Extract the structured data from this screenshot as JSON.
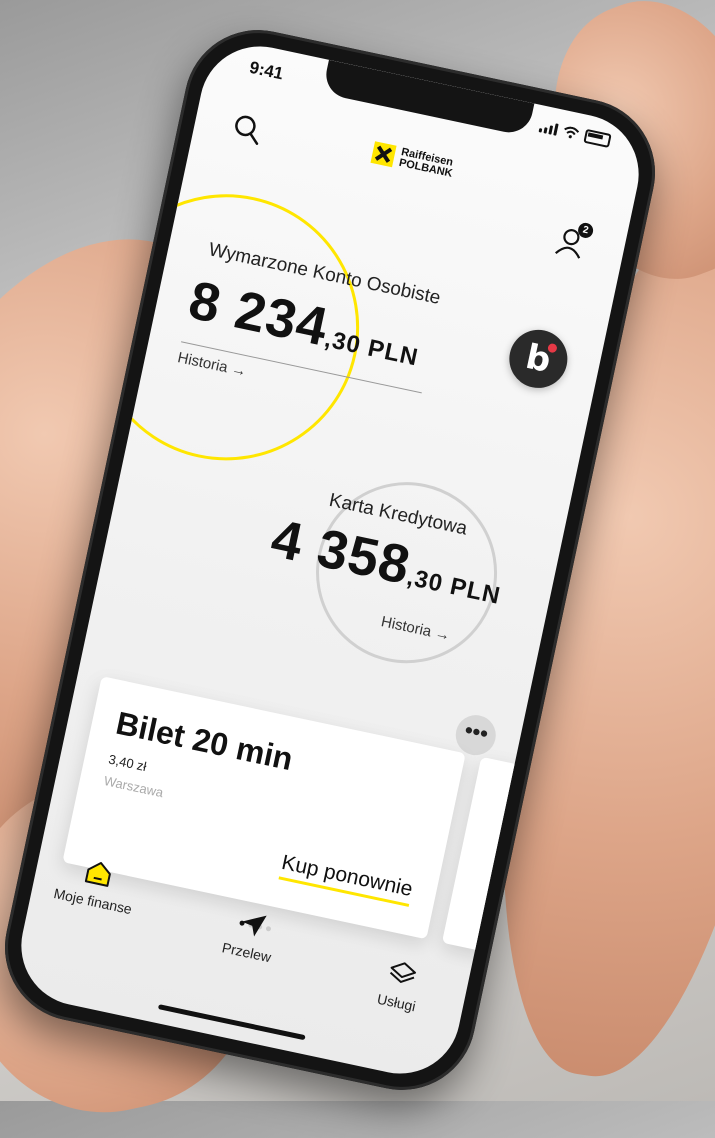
{
  "status": {
    "time": "9:41"
  },
  "brand": {
    "name_line1": "Raiffeisen",
    "name_line2": "POLBANK",
    "accent": "#ffe600"
  },
  "header": {
    "profile_badge": "2"
  },
  "accounts": [
    {
      "name": "Wymarzone Konto Osobiste",
      "amount_main": "8 234",
      "amount_decimal": ",30 PLN",
      "link": "Historia →"
    },
    {
      "name": "Karta Kredytowa",
      "amount_main": "4 358",
      "amount_decimal": ",30 PLN",
      "link": "Historia →"
    }
  ],
  "more_button": {
    "label": "•••"
  },
  "quick_card": {
    "title": "Bilet 20 min",
    "price": "3,40 zł",
    "city": "Warszawa",
    "action": "Kup ponownie"
  },
  "nav": [
    {
      "label": "Moje finanse",
      "icon": "home-icon"
    },
    {
      "label": "Przelew",
      "icon": "send-icon"
    },
    {
      "label": "Usługi",
      "icon": "layers-icon"
    }
  ]
}
